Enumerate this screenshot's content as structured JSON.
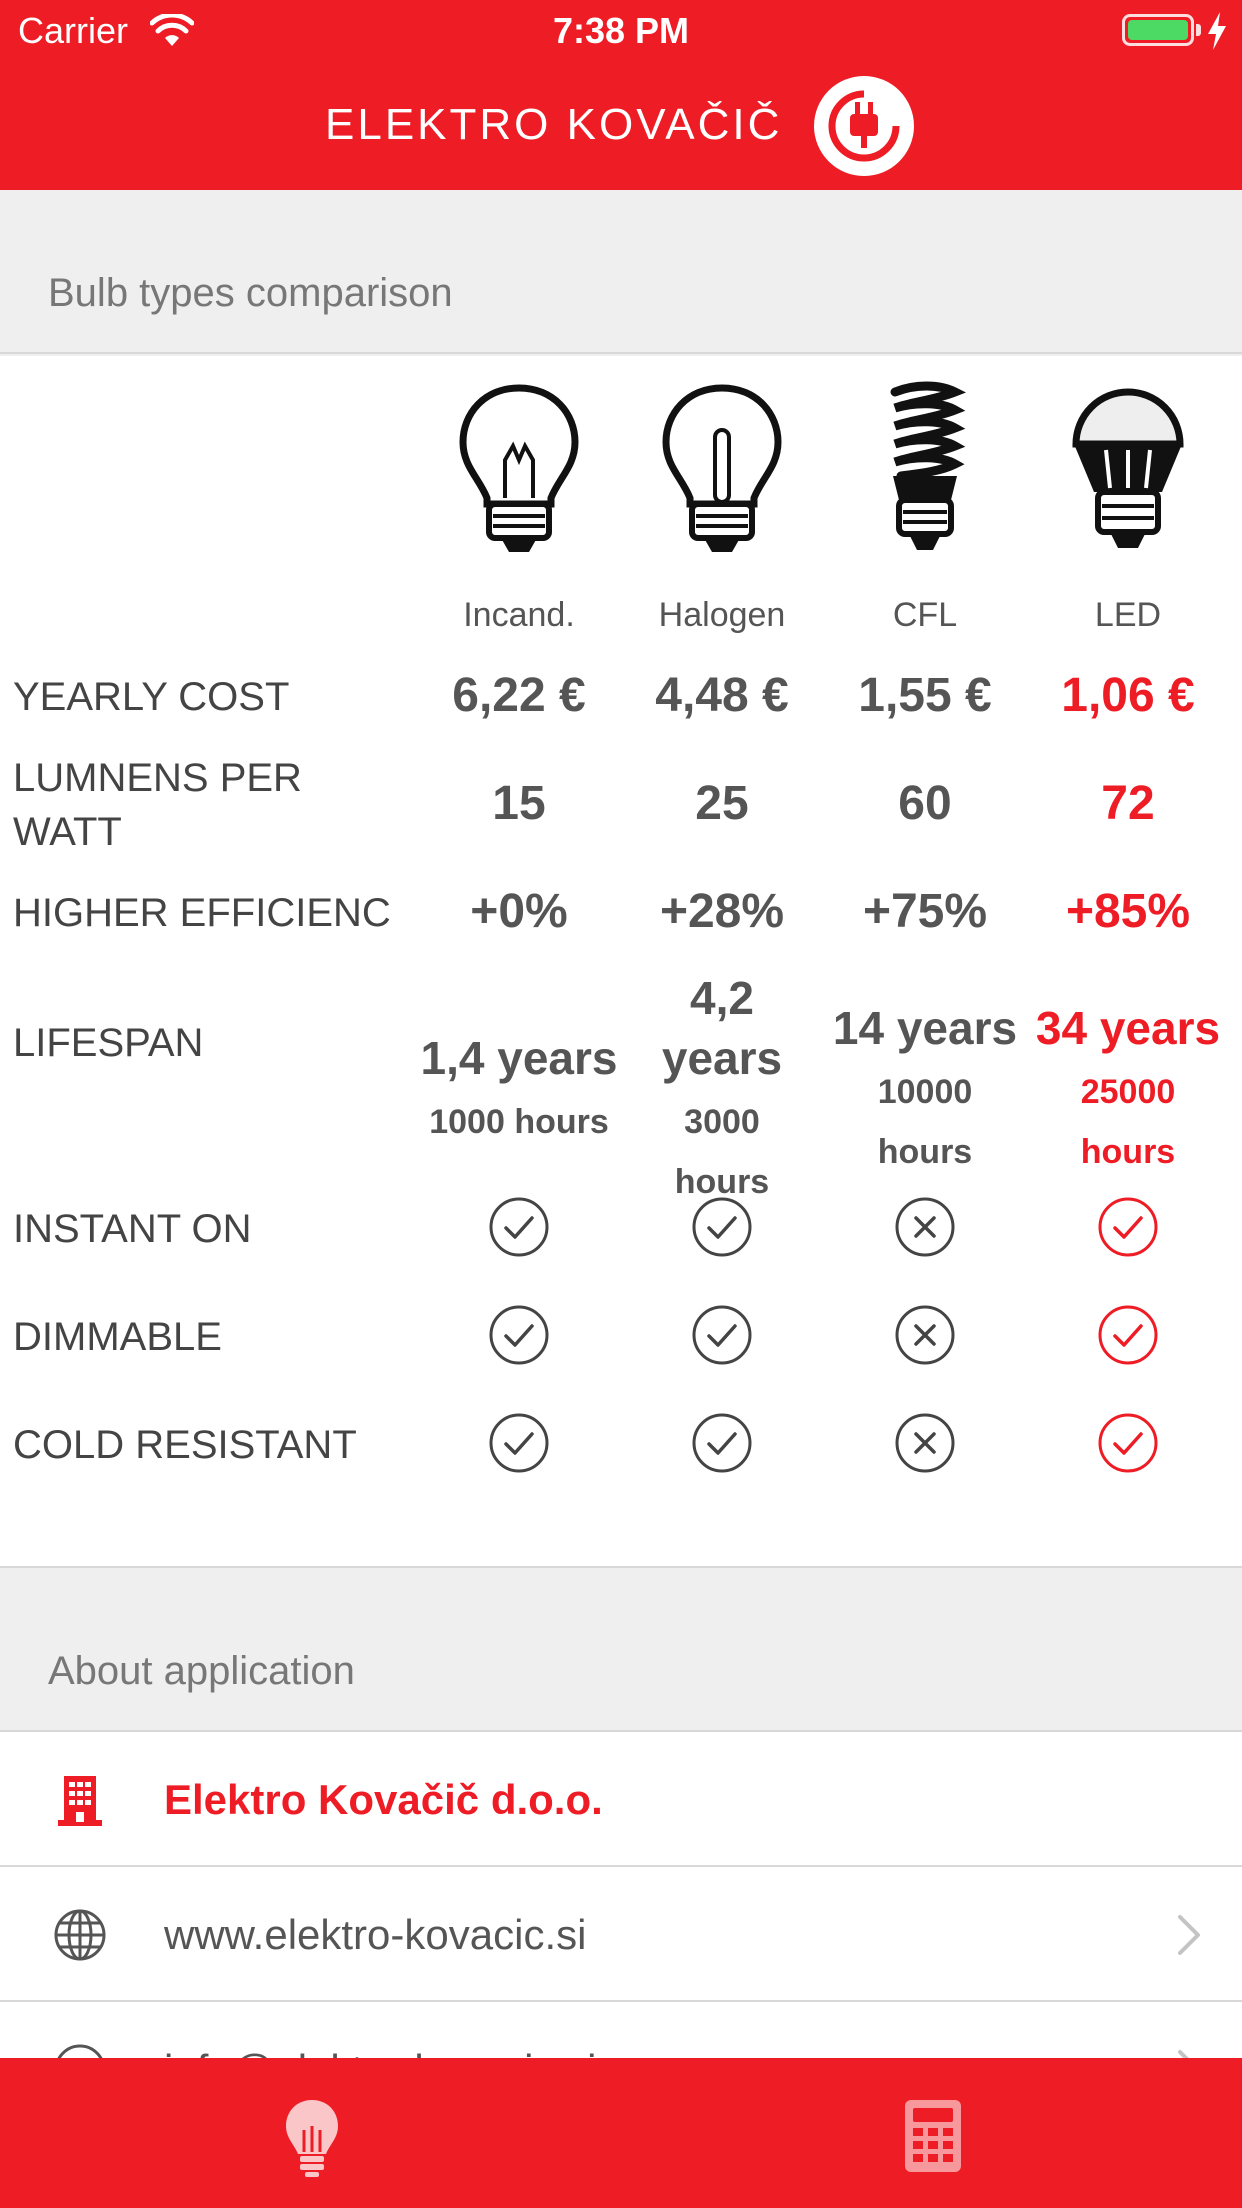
{
  "status_bar": {
    "carrier": "Carrier",
    "time": "7:38 PM"
  },
  "header": {
    "brand": "ELEKTRO KOVAČIČ"
  },
  "comparison": {
    "section_title": "Bulb types comparison",
    "bulbs": [
      {
        "label": "Incand.",
        "icon": "incandescent-bulb-icon"
      },
      {
        "label": "Halogen",
        "icon": "halogen-bulb-icon"
      },
      {
        "label": "CFL",
        "icon": "cfl-bulb-icon"
      },
      {
        "label": "LED",
        "icon": "led-bulb-icon"
      }
    ],
    "rows": {
      "yearly_cost": {
        "label": "YEARLY COST",
        "values": [
          "6,22 €",
          "4,48 €",
          "1,55 €",
          "1,06 €"
        ]
      },
      "lumens": {
        "label": "LUMNENS PER WATT",
        "values": [
          "15",
          "25",
          "60",
          "72"
        ]
      },
      "efficiency": {
        "label": "HIGHER EFFICIENC",
        "values": [
          "+0%",
          "+28%",
          "+75%",
          "+85%"
        ]
      },
      "lifespan": {
        "label": "LIFESPAN",
        "years": [
          "1,4 years",
          "4,2 years",
          "14 years",
          "34 years"
        ],
        "hours": [
          "1000 hours",
          "3000 hours",
          "10000 hours",
          "25000 hours"
        ]
      },
      "instant_on": {
        "label": "INSTANT ON",
        "values": [
          true,
          true,
          false,
          true
        ]
      },
      "dimmable": {
        "label": "DIMMABLE",
        "values": [
          true,
          true,
          false,
          true
        ]
      },
      "cold_resistant": {
        "label": "COLD RESISTANT",
        "values": [
          true,
          true,
          false,
          true
        ]
      }
    }
  },
  "about": {
    "section_title": "About application",
    "items": [
      {
        "text": "Elektro Kovačič d.o.o.",
        "icon": "building-icon"
      },
      {
        "text": "www.elektro-kovacic.si",
        "icon": "globe-icon"
      },
      {
        "text": "info@elektro-kovacic.si",
        "icon": "mail-icon"
      }
    ]
  },
  "tabs": [
    {
      "icon": "light-bulb-icon"
    },
    {
      "icon": "calculator-icon"
    }
  ],
  "colors": {
    "accent": "#ee1c25",
    "text": "#555555",
    "background": "#efefef"
  }
}
